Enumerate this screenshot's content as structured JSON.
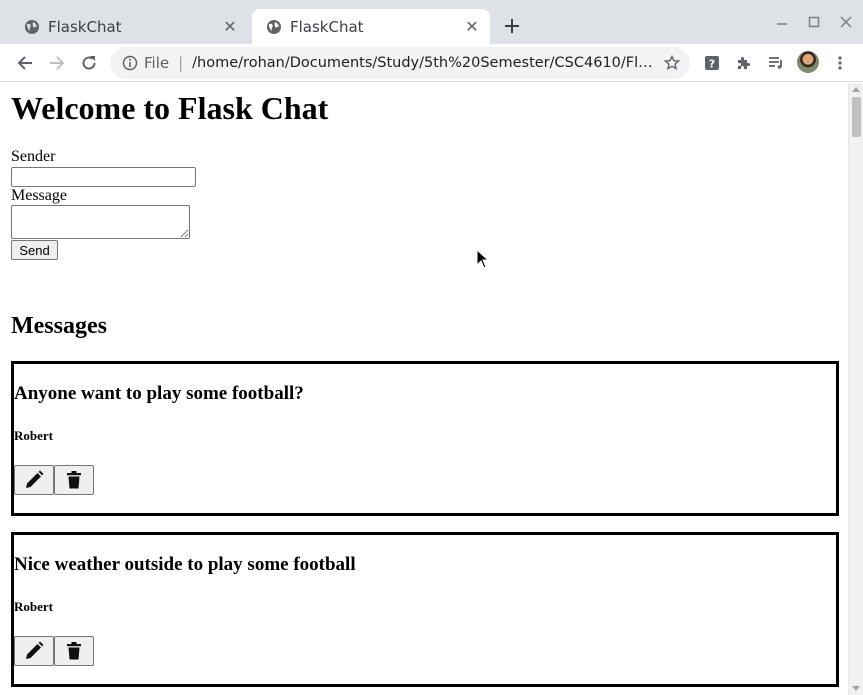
{
  "browser": {
    "tabs": [
      {
        "title": "FlaskChat",
        "active": false
      },
      {
        "title": "FlaskChat",
        "active": true
      }
    ],
    "address_scheme": "File",
    "address_url": "/home/rohan/Documents/Study/5th%20Semester/CSC4610/Flask-Fire…"
  },
  "page": {
    "title": "Welcome to Flask Chat",
    "form": {
      "sender_label": "Sender",
      "sender_value": "",
      "message_label": "Message",
      "message_value": "",
      "send_label": "Send"
    },
    "messages_heading": "Messages",
    "messages": [
      {
        "text": "Anyone want to play some football?",
        "sender": "Robert"
      },
      {
        "text": "Nice weather outside to play some football",
        "sender": "Robert"
      }
    ]
  },
  "icons": {
    "tab": "globe-icon",
    "edit": "pencil-icon",
    "delete": "trash-icon"
  }
}
